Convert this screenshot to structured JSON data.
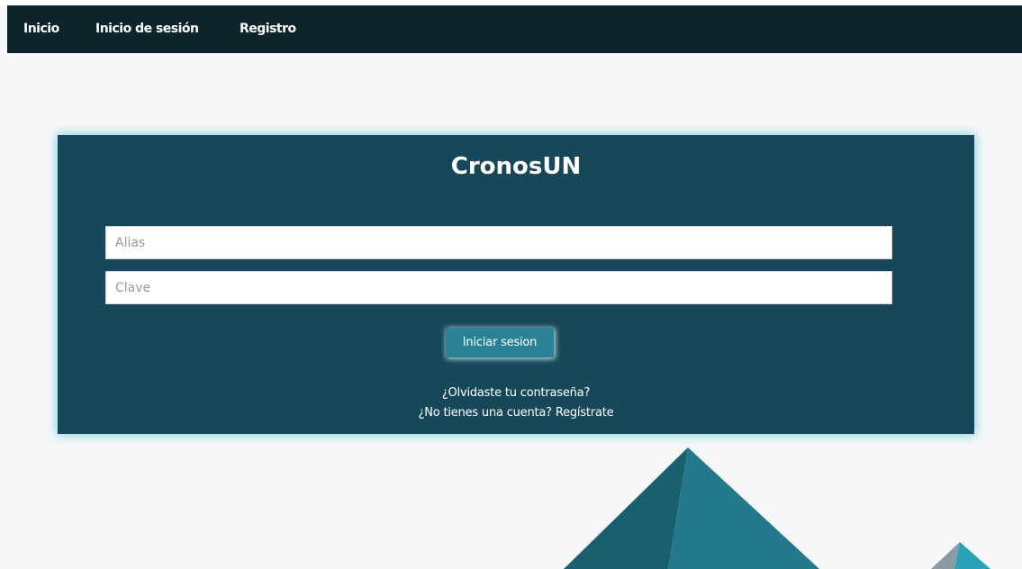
{
  "nav": {
    "home_label": "Inicio",
    "login_label": "Inicio de sesión",
    "register_label": "Registro"
  },
  "login": {
    "title": "CronosUN",
    "alias_placeholder": "Alias",
    "password_placeholder": "Clave",
    "submit_label": "Iniciar sesion",
    "forgot_link": "¿Olvidaste tu contraseña?",
    "signup_link": "¿No tienes una cuenta? Regístrate"
  },
  "colors": {
    "navbar": "#0e242d",
    "card": "#164859",
    "button": "#2a8294",
    "mountain_dark": "#1a5f70",
    "mountain_light": "#23798b",
    "mountain_small": "#2aa3b8"
  }
}
